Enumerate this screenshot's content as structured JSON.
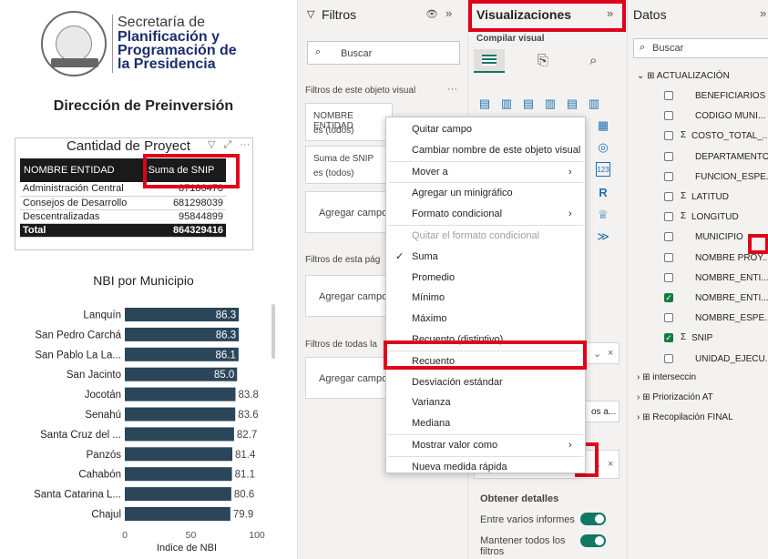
{
  "report": {
    "org_line1": "Secretaría de",
    "org_line2": "Planificación y",
    "org_line3": "Programación de",
    "org_line4": "la Presidencia",
    "seal_text_top": "GOBIERNO DE LA REPÚBLICA",
    "seal_text_bottom": "GUATEMALA",
    "title": "Dirección de Preinversión",
    "table": {
      "title": "Cantidad de Proyect",
      "col1": "NOMBRE ENTIDAD",
      "col2": "Suma de SNIP",
      "rows": [
        {
          "name": "Administración Central",
          "value": "87186478"
        },
        {
          "name": "Consejos de Desarrollo",
          "value": "681298039"
        },
        {
          "name": "Descentralizadas",
          "value": "95844899"
        }
      ],
      "total_label": "Total",
      "total_value": "864329416"
    },
    "chart_title": "NBI por Municipio",
    "axis_title": "Indice de NBI"
  },
  "chart_data": {
    "type": "bar",
    "orientation": "horizontal",
    "title": "NBI por Municipio",
    "xlabel": "Indice de NBI",
    "ylabel": "",
    "xlim": [
      0,
      100
    ],
    "xticks": [
      "0",
      "50",
      "100"
    ],
    "categories": [
      "Lanquín",
      "San Pedro Carchá",
      "San Pablo La La...",
      "San Jacinto",
      "Jocotán",
      "Senahú",
      "Santa Cruz del ...",
      "Panzós",
      "Cahabón",
      "Santa Catarina L...",
      "Chajul"
    ],
    "values": [
      86.3,
      86.3,
      86.1,
      85.0,
      83.8,
      83.6,
      82.7,
      81.4,
      81.1,
      80.6,
      79.9
    ],
    "labels": [
      "86.3",
      "86.3",
      "86.1",
      "85.0",
      "83.8",
      "83.6",
      "82.7",
      "81.4",
      "81.1",
      "80.6",
      "79.9"
    ],
    "bar_color": "#2b4559"
  },
  "filtros": {
    "title": "Filtros",
    "search_placeholder": "Buscar",
    "visual_section": "Filtros de este objeto visual",
    "card1_title": "NOMBRE ENTIDAD",
    "card1_sub": "es (todos)",
    "card2_title": "Suma de SNIP",
    "card2_sub": "es (todos)",
    "add_field": "Agregar campo",
    "page_section": "Filtros de esta pág",
    "all_section": "Filtros de todas la"
  },
  "viz": {
    "title": "Visualizaciones",
    "build_label": "Compilar visual",
    "field_partial": "os a...",
    "details_label": "Obtener detalles",
    "toggle1_label": "Entre varios informes",
    "toggle2_label": "Mantener todos los filtros"
  },
  "datos": {
    "title": "Datos",
    "search_placeholder": "Buscar",
    "table_name": "ACTUALIZACIÓN",
    "fields": [
      {
        "label": "BENEFICIARIOS",
        "sigma": false,
        "checked": false
      },
      {
        "label": "CODIGO MUNI...",
        "sigma": false,
        "checked": false
      },
      {
        "label": "COSTO_TOTAL_...",
        "sigma": true,
        "checked": false
      },
      {
        "label": "DEPARTAMENTO",
        "sigma": false,
        "checked": false
      },
      {
        "label": "FUNCION_ESPE...",
        "sigma": false,
        "checked": false
      },
      {
        "label": "LATITUD",
        "sigma": true,
        "checked": false
      },
      {
        "label": "LONGITUD",
        "sigma": true,
        "checked": false
      },
      {
        "label": "MUNICIPIO",
        "sigma": false,
        "checked": false
      },
      {
        "label": "NOMBRE PROY...",
        "sigma": false,
        "checked": false
      },
      {
        "label": "NOMBRE_ENTI...",
        "sigma": false,
        "checked": false
      },
      {
        "label": "NOMBRE_ENTI...",
        "sigma": false,
        "checked": true
      },
      {
        "label": "NOMBRE_ESPE...",
        "sigma": false,
        "checked": false
      },
      {
        "label": "SNIP",
        "sigma": true,
        "checked": true
      },
      {
        "label": "UNIDAD_EJECU...",
        "sigma": false,
        "checked": false
      }
    ],
    "other_tables": [
      "interseccin",
      "Priorización AT",
      "Recopilación FINAL"
    ]
  },
  "menu": {
    "items": [
      {
        "label": "Quitar campo",
        "disabled": false,
        "check": false,
        "sub": false
      },
      {
        "label": "Cambiar nombre de este objeto visual",
        "disabled": false,
        "check": false,
        "sub": false
      },
      {
        "label": "Mover a",
        "disabled": false,
        "check": false,
        "sub": true
      },
      {
        "label": "Agregar un minigráfico",
        "disabled": false,
        "check": false,
        "sub": false
      },
      {
        "label": "Formato condicional",
        "disabled": false,
        "check": false,
        "sub": true
      },
      {
        "label": "Quitar el formato condicional",
        "disabled": true,
        "check": false,
        "sub": false
      },
      {
        "label": "Suma",
        "disabled": false,
        "check": true,
        "sub": false
      },
      {
        "label": "Promedio",
        "disabled": false,
        "check": false,
        "sub": false
      },
      {
        "label": "Mínimo",
        "disabled": false,
        "check": false,
        "sub": false
      },
      {
        "label": "Máximo",
        "disabled": false,
        "check": false,
        "sub": false
      },
      {
        "label": "Recuento (distintivo)",
        "disabled": false,
        "check": false,
        "sub": false
      },
      {
        "label": "Recuento",
        "disabled": false,
        "check": false,
        "sub": false
      },
      {
        "label": "Desviación estándar",
        "disabled": false,
        "check": false,
        "sub": false
      },
      {
        "label": "Varianza",
        "disabled": false,
        "check": false,
        "sub": false
      },
      {
        "label": "Mediana",
        "disabled": false,
        "check": false,
        "sub": false
      },
      {
        "label": "Mostrar valor como",
        "disabled": false,
        "check": false,
        "sub": true
      },
      {
        "label": "Nueva medida rápida",
        "disabled": false,
        "check": false,
        "sub": false
      }
    ]
  },
  "colors": {
    "highlight": "#e0001a",
    "bar": "#2b4559",
    "toggle_on": "#117865",
    "brand_navy": "#1b2e6b"
  }
}
